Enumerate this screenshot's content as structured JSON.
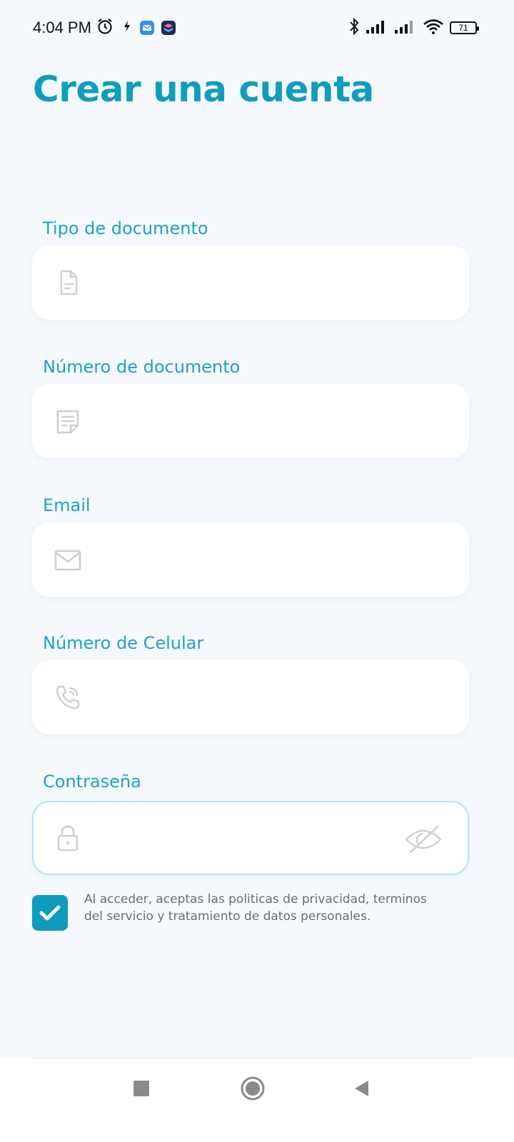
{
  "status_bar": {
    "time": "4:04 PM",
    "battery": "71",
    "left_icons": [
      "alarm-icon",
      "bolt-icon",
      "mail-app-icon",
      "shortcut-app-icon"
    ],
    "right_icons": [
      "bluetooth-icon",
      "signal-icon",
      "signal-icon",
      "wifi-icon",
      "battery-icon"
    ]
  },
  "page": {
    "title": "Crear una cuenta"
  },
  "form": {
    "fields": [
      {
        "label": "Tipo de documento",
        "icon": "document-icon",
        "value": ""
      },
      {
        "label": "Número de documento",
        "icon": "notes-icon",
        "value": ""
      },
      {
        "label": "Email",
        "icon": "mail-icon",
        "value": ""
      },
      {
        "label": "Número de Celular",
        "icon": "phone-icon",
        "value": ""
      },
      {
        "label": "Contraseña",
        "icon": "lock-icon",
        "value": "",
        "trailing_icon": "eye-off-icon"
      }
    ]
  },
  "consent": {
    "checked": true,
    "text": "Al acceder, aceptas las politicas de privacidad, terminos del servicio y tratamiento de datos personales."
  },
  "nav_bar": {
    "buttons": [
      "recents-button",
      "home-button",
      "back-button"
    ]
  },
  "colors": {
    "accent": "#0f9dbd",
    "label": "#1fa2c4",
    "background": "#f5f9fd",
    "field": "#ffffff",
    "icon_gray": "#cfcfcf"
  }
}
